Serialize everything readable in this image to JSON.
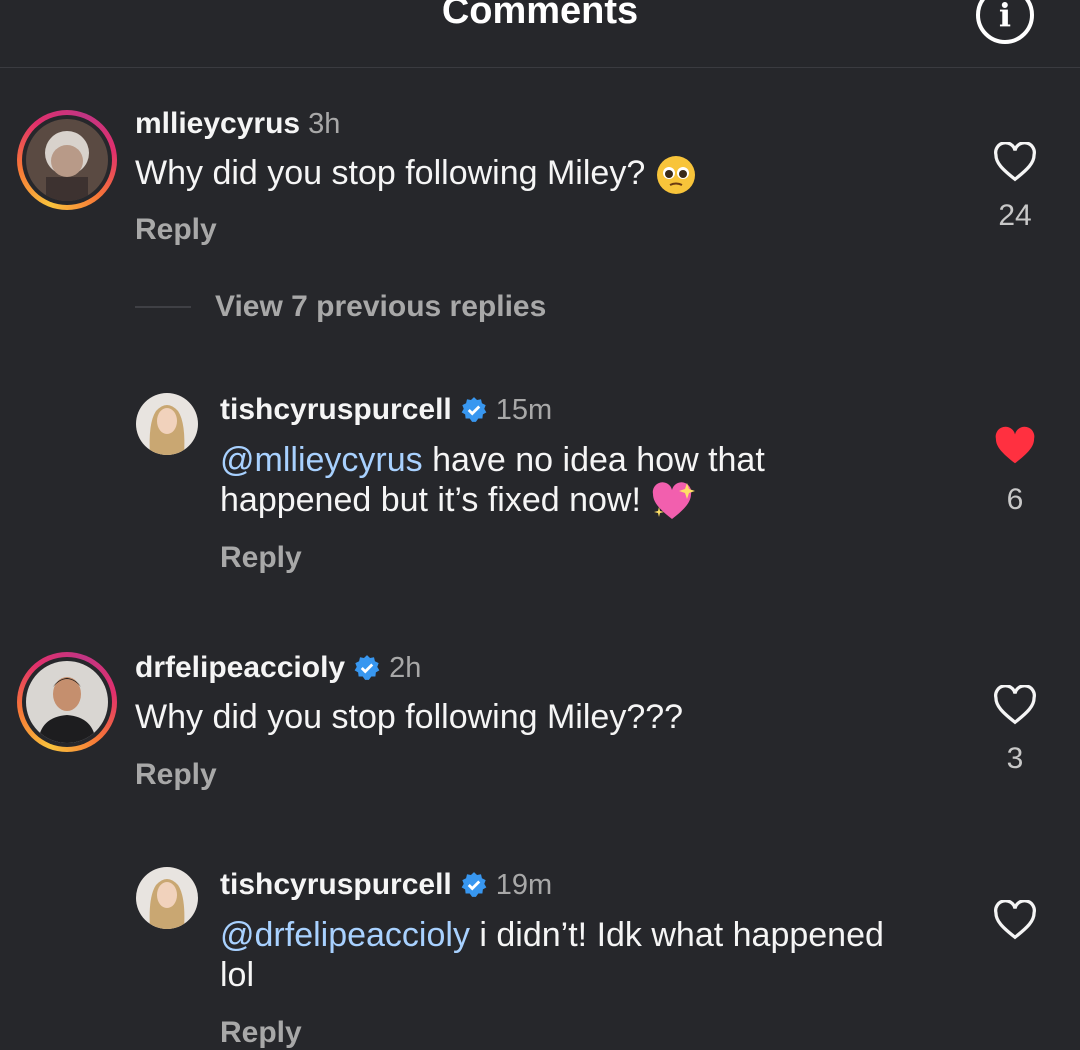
{
  "header": {
    "title": "Comments",
    "info_glyph": "i"
  },
  "comments": [
    {
      "username": "mllieycyrus",
      "time": "3h",
      "text": "Why did you stop following Miley?",
      "emoji": "pleading-face-emoji",
      "reply_label": "Reply",
      "likes": "24",
      "liked": false,
      "verified": false
    },
    {
      "username": "tishcyruspurcell",
      "time": "15m",
      "mention": "@mllieycyrus",
      "text_line1": " have no idea how that",
      "text_line2": "happened but it’s fixed now!",
      "emoji": "sparkling-heart-emoji",
      "reply_label": "Reply",
      "likes": "6",
      "liked": true,
      "verified": true
    },
    {
      "username": "drfelipeaccioly",
      "time": "2h",
      "text": "Why did you stop following Miley???",
      "reply_label": "Reply",
      "likes": "3",
      "liked": false,
      "verified": true
    },
    {
      "username": "tishcyruspurcell",
      "time": "19m",
      "mention": "@drfelipeaccioly",
      "text_line1": " i didn’t! Idk what happened",
      "text_line2": "lol",
      "reply_label": "Reply",
      "liked": false,
      "verified": true
    }
  ],
  "view_replies": {
    "label": "View 7 previous replies"
  },
  "colors": {
    "background": "#26272b",
    "mention": "#a8d1ff",
    "verified": "#3897f0",
    "liked_heart": "#ff3040",
    "secondary_text": "#a8a8a8"
  }
}
